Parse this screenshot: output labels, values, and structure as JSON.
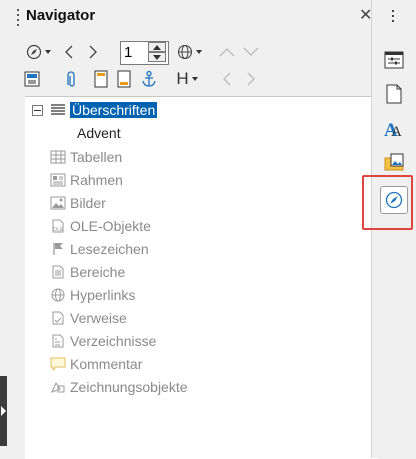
{
  "navigator": {
    "title": "Navigator",
    "close_glyph": "✕",
    "page_number": "1",
    "heading_style_letter": "H"
  },
  "tree": {
    "categories": [
      {
        "label": "Überschriften",
        "icon": "headings-icon",
        "selected": true
      },
      {
        "label": "Tabellen",
        "icon": "table-icon"
      },
      {
        "label": "Rahmen",
        "icon": "frame-icon"
      },
      {
        "label": "Bilder",
        "icon": "image-icon"
      },
      {
        "label": "OLE-Objekte",
        "icon": "ole-icon"
      },
      {
        "label": "Lesezeichen",
        "icon": "bookmark-icon"
      },
      {
        "label": "Bereiche",
        "icon": "section-icon"
      },
      {
        "label": "Hyperlinks",
        "icon": "globe-icon"
      },
      {
        "label": "Verweise",
        "icon": "reference-icon"
      },
      {
        "label": "Verzeichnisse",
        "icon": "index-icon"
      },
      {
        "label": "Kommentar",
        "icon": "comment-icon"
      },
      {
        "label": "Zeichnungsobjekte",
        "icon": "drawing-icon"
      }
    ],
    "child": {
      "label": "Advent"
    }
  },
  "sidebar": {
    "buttons": [
      "properties-icon",
      "page-icon",
      "styles-icon",
      "gallery-icon",
      "navigator-icon"
    ],
    "more_glyph": "⋮"
  },
  "colors": {
    "selection": "#0063b1",
    "highlight_border": "#e0443e",
    "anchor_blue": "#1e73be",
    "icon_gray": "#9a9a9a"
  }
}
